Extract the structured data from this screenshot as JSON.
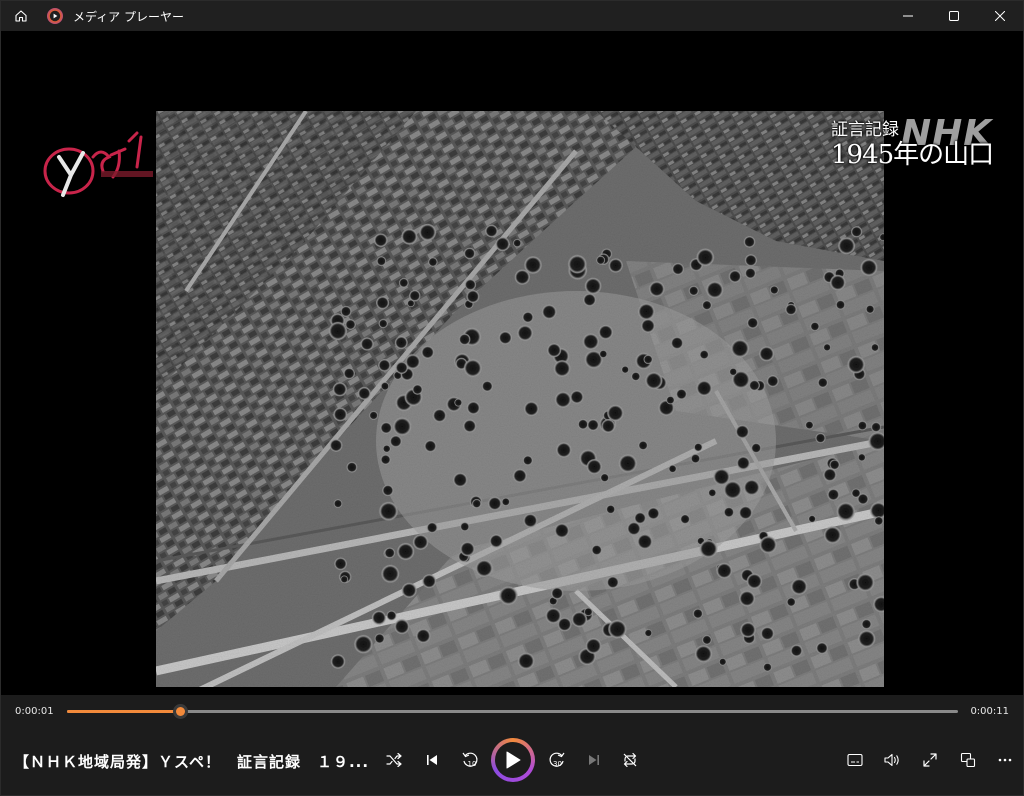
{
  "window": {
    "title": "メディア プレーヤー"
  },
  "overlay": {
    "program_subtitle": "証言記録",
    "program_title": "1945年の山口",
    "broadcaster_logo": "NHK",
    "show_logo": "Yスペ!"
  },
  "player": {
    "current_time": "0:00:01",
    "duration": "0:00:11",
    "progress_fraction": 0.127,
    "now_playing": "【ＮＨＫ地域局発】Ｙスペ！　証言記録　１９...",
    "accent_color": "#f28a3b",
    "ring_color_secondary": "#b04bd8",
    "state": "paused"
  },
  "icons": {
    "home": "home-icon",
    "app": "media-player-logo-icon",
    "minimize": "minimize-icon",
    "maximize": "maximize-icon",
    "close": "close-icon",
    "shuffle": "shuffle-icon",
    "previous": "previous-icon",
    "skip_back": "skip-back-10-icon",
    "play": "play-icon",
    "skip_forward": "skip-forward-30-icon",
    "next": "next-icon",
    "repeat": "repeat-off-icon",
    "captions": "captions-icon",
    "volume": "volume-icon",
    "fullscreen": "fullscreen-icon",
    "miniplayer": "miniplayer-icon",
    "more": "more-icon"
  }
}
